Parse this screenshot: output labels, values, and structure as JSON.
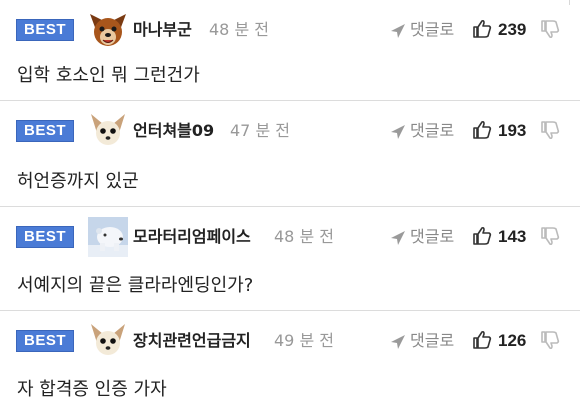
{
  "comments": [
    {
      "badge": "BEST",
      "nickname": "마나부군",
      "time": "48 분 전",
      "reply_label": "댓글로",
      "likes": "239",
      "text": "입학 호소인 뭐 그런건가",
      "avatar": "dog-face-avatar"
    },
    {
      "badge": "BEST",
      "nickname": "언터쳐블09",
      "time": "47 분 전",
      "reply_label": "댓글로",
      "likes": "193",
      "text": "허언증까지 있군",
      "avatar": "chihuahua-avatar"
    },
    {
      "badge": "BEST",
      "nickname": "모라터리엄페이스",
      "time": "48 분 전",
      "reply_label": "댓글로",
      "likes": "143",
      "text": "서예지의 끝은 클라라엔딩인가?",
      "avatar": "polar-bear-avatar"
    },
    {
      "badge": "BEST",
      "nickname": "장치관련언급금지",
      "time": "49 분 전",
      "reply_label": "댓글로",
      "likes": "126",
      "text": "자 합격증 인증 가자",
      "avatar": "chihuahua-avatar"
    }
  ],
  "icons": {
    "reply": "send-arrow-icon",
    "like": "thumbs-up-icon",
    "dislike": "thumbs-down-icon"
  },
  "colors": {
    "badge_bg": "#4a7bd6",
    "meta_text": "#999999",
    "divider": "#dcdcdc"
  }
}
